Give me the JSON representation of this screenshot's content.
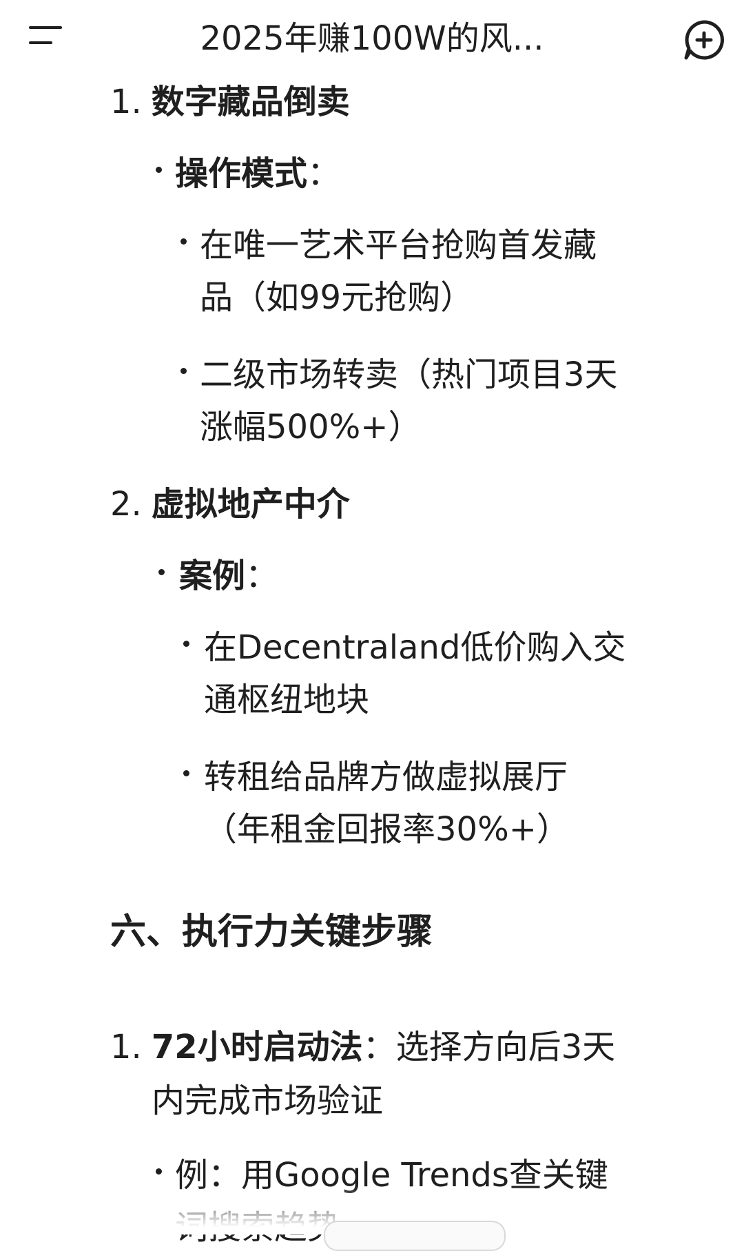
{
  "header": {
    "title": "2025年赚100W的风...",
    "menu_icon": "menu-icon",
    "new_chat_icon": "add-chat-icon"
  },
  "content": {
    "item1": {
      "number": "1.",
      "title": "数字藏品倒卖",
      "sub_label": "操作模式",
      "sub_label_suffix": "：",
      "bullets": [
        {
          "line1": "在唯一艺术平台抢购首发藏",
          "line2": "品（如99元抢购）"
        },
        {
          "line1": "二级市场转卖（热门项目3天",
          "line2": "涨幅500%+）"
        }
      ]
    },
    "item2": {
      "number": "2.",
      "title": "虚拟地产中介",
      "sub_label": "案例",
      "sub_label_suffix": "：",
      "bullets": [
        {
          "line1": "在Decentraland低价购入交",
          "line2": "通枢纽地块"
        },
        {
          "line1": "转租给品牌方做虚拟展厅",
          "line2": "（年租金回报率30%+）"
        }
      ]
    },
    "section6": {
      "heading": "六、执行力关键步骤",
      "item1": {
        "number": "1.",
        "bold": "72小时启动法",
        "rest": "：选择方向后3天",
        "line2": "内完成市场验证",
        "example": {
          "line1": "例：用Google Trends查关键",
          "line2": "词搜索趋势"
        }
      }
    }
  }
}
